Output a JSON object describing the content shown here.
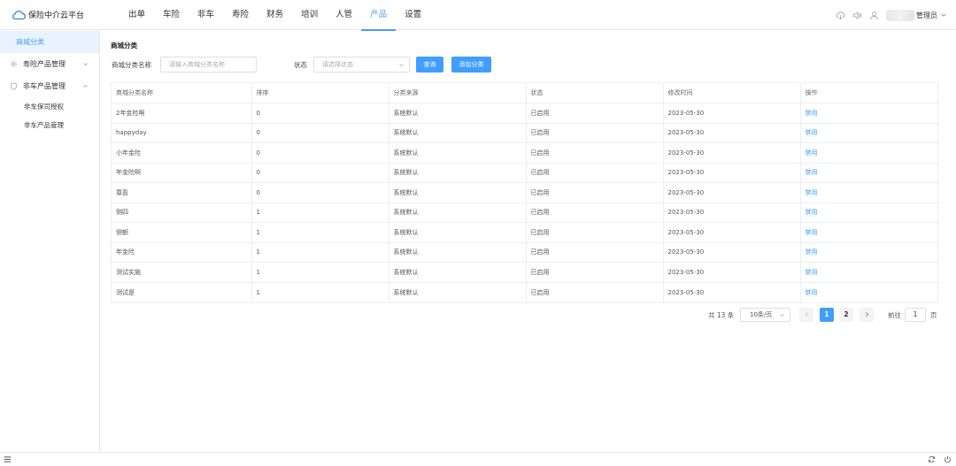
{
  "app": {
    "title": "保险中介云平台"
  },
  "nav": [
    {
      "label": "出单",
      "active": false
    },
    {
      "label": "车险",
      "active": false
    },
    {
      "label": "非车",
      "active": false
    },
    {
      "label": "寿险",
      "active": false
    },
    {
      "label": "财务",
      "active": false
    },
    {
      "label": "培训",
      "active": false
    },
    {
      "label": "人管",
      "active": false
    },
    {
      "label": "产品",
      "active": true
    },
    {
      "label": "设置",
      "active": false
    }
  ],
  "header_right": {
    "user_label": "管理员",
    "icons": [
      "cloud-download-icon",
      "speaker-icon",
      "user-icon"
    ]
  },
  "sidebar": {
    "active_item": "商城分类",
    "groups": [
      {
        "label": "寿险产品管理",
        "icon": "gear-icon",
        "expanded": false,
        "children": []
      },
      {
        "label": "非车产品管理",
        "icon": "shield-icon",
        "expanded": true,
        "children": [
          "非车保司授权",
          "非车产品管理"
        ]
      }
    ]
  },
  "main": {
    "section_title": "商城分类",
    "filters": {
      "name_label": "商城分类名称",
      "name_placeholder": "请输入商城分类名称",
      "status_label": "状态",
      "status_placeholder": "请选择状态",
      "search_button": "查询",
      "add_button": "添加分类"
    },
    "table": {
      "columns": [
        "商城分类名称",
        "排序",
        "分类来源",
        "状态",
        "修改时间",
        "操作"
      ],
      "rows": [
        [
          "2年金险啊",
          "0",
          "系统默认",
          "已启用",
          "2023-05-30",
          "禁用"
        ],
        [
          "happyday",
          "0",
          "系统默认",
          "已启用",
          "2023-05-30",
          "禁用"
        ],
        [
          "小年金险",
          "0",
          "系统默认",
          "已启用",
          "2023-05-30",
          "禁用"
        ],
        [
          "年金险啊",
          "0",
          "系统默认",
          "已启用",
          "2023-05-30",
          "禁用"
        ],
        [
          "尊盈",
          "0",
          "系统默认",
          "已启用",
          "2023-05-30",
          "禁用"
        ],
        [
          "侧四",
          "1",
          "系统默认",
          "已启用",
          "2023-05-30",
          "禁用"
        ],
        [
          "侧额",
          "1",
          "系统默认",
          "已启用",
          "2023-05-30",
          "禁用"
        ],
        [
          "年金险",
          "1",
          "系统默认",
          "已启用",
          "2023-05-30",
          "禁用"
        ],
        [
          "测试实施",
          "1",
          "系统默认",
          "已启用",
          "2023-05-30",
          "禁用"
        ],
        [
          "测试是",
          "1",
          "系统默认",
          "已启用",
          "2023-05-30",
          "禁用"
        ]
      ]
    },
    "pagination": {
      "total_text": "共 13 条",
      "page_size": "10条/页",
      "pages": [
        "1",
        "2"
      ],
      "current_page": "1",
      "jump_prefix": "前往",
      "jump_value": "1",
      "jump_suffix": "页"
    }
  },
  "colors": {
    "primary": "#409eff",
    "nav_active": "#4a9cf2",
    "sidebar_active_bg": "#e9f3ff"
  }
}
